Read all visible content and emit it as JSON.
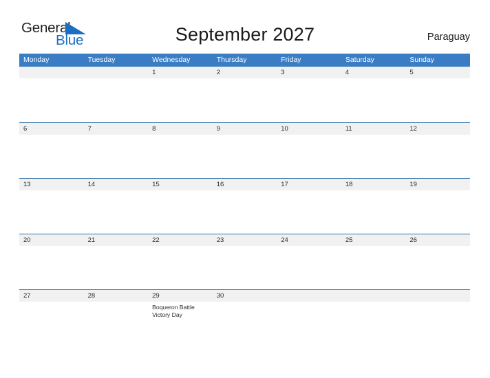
{
  "brand": {
    "name_part1": "General",
    "name_part2": "Blue",
    "flag_icon": "triangle-flag-icon",
    "color_dark": "#231f20",
    "color_blue": "#1b6ec2"
  },
  "header": {
    "title": "September 2027",
    "country": "Paraguay"
  },
  "calendar": {
    "month": "September",
    "year": "2027",
    "header_bg": "#3b7dc4",
    "row_line_color": "#2e6da4",
    "band_bg": "#f1f1f1",
    "weekday_headers": [
      "Monday",
      "Tuesday",
      "Wednesday",
      "Thursday",
      "Friday",
      "Saturday",
      "Sunday"
    ],
    "weeks": [
      [
        {
          "day": "",
          "events": []
        },
        {
          "day": "",
          "events": []
        },
        {
          "day": "1",
          "events": []
        },
        {
          "day": "2",
          "events": []
        },
        {
          "day": "3",
          "events": []
        },
        {
          "day": "4",
          "events": []
        },
        {
          "day": "5",
          "events": []
        }
      ],
      [
        {
          "day": "6",
          "events": []
        },
        {
          "day": "7",
          "events": []
        },
        {
          "day": "8",
          "events": []
        },
        {
          "day": "9",
          "events": []
        },
        {
          "day": "10",
          "events": []
        },
        {
          "day": "11",
          "events": []
        },
        {
          "day": "12",
          "events": []
        }
      ],
      [
        {
          "day": "13",
          "events": []
        },
        {
          "day": "14",
          "events": []
        },
        {
          "day": "15",
          "events": []
        },
        {
          "day": "16",
          "events": []
        },
        {
          "day": "17",
          "events": []
        },
        {
          "day": "18",
          "events": []
        },
        {
          "day": "19",
          "events": []
        }
      ],
      [
        {
          "day": "20",
          "events": []
        },
        {
          "day": "21",
          "events": []
        },
        {
          "day": "22",
          "events": []
        },
        {
          "day": "23",
          "events": []
        },
        {
          "day": "24",
          "events": []
        },
        {
          "day": "25",
          "events": []
        },
        {
          "day": "26",
          "events": []
        }
      ],
      [
        {
          "day": "27",
          "events": []
        },
        {
          "day": "28",
          "events": []
        },
        {
          "day": "29",
          "events": [
            "Boqueron Battle Victory Day"
          ]
        },
        {
          "day": "30",
          "events": []
        },
        {
          "day": "",
          "events": []
        },
        {
          "day": "",
          "events": []
        },
        {
          "day": "",
          "events": []
        }
      ]
    ]
  }
}
